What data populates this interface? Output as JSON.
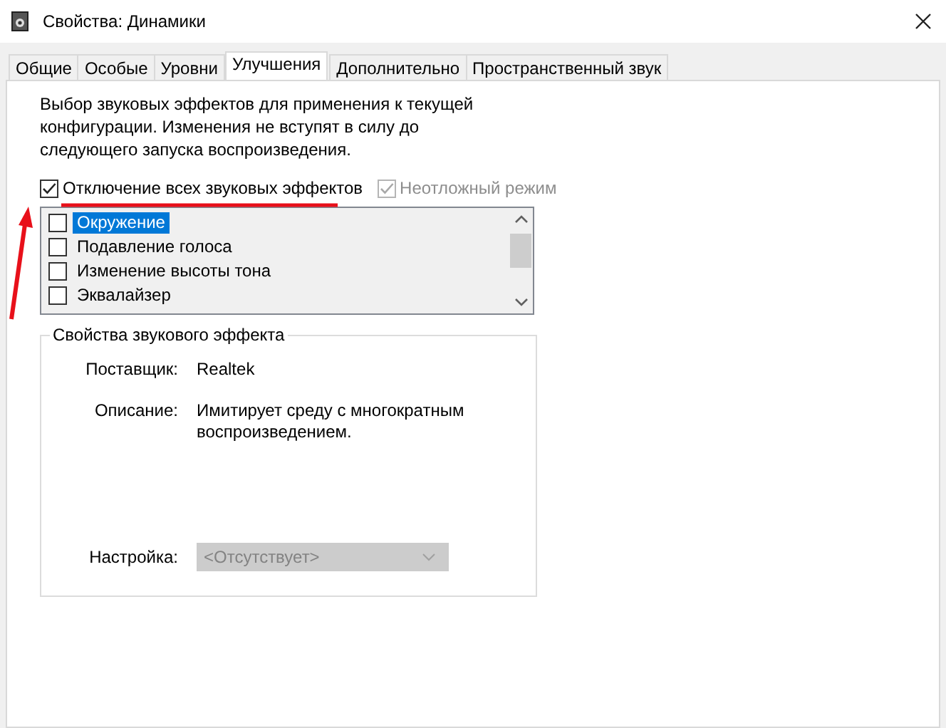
{
  "window": {
    "title": "Свойства: Динамики"
  },
  "tabs": [
    {
      "label": "Общие",
      "selected": false
    },
    {
      "label": "Особые",
      "selected": false
    },
    {
      "label": "Уровни",
      "selected": false
    },
    {
      "label": "Улучшения",
      "selected": true
    },
    {
      "label": "Дополнительно",
      "selected": false
    },
    {
      "label": "Пространственный звук",
      "selected": false
    }
  ],
  "description": "Выбор звуковых эффектов для применения к текущей конфигурации. Изменения не вступят в силу до следующего запуска воспроизведения.",
  "options": [
    {
      "label": "Отключение всех звуковых эффектов",
      "checked": true,
      "disabled": false
    },
    {
      "label": "Неотложный режим",
      "checked": true,
      "disabled": true
    }
  ],
  "effects": [
    {
      "label": "Окружение",
      "checked": false,
      "selected": true
    },
    {
      "label": "Подавление голоса",
      "checked": false,
      "selected": false
    },
    {
      "label": "Изменение высоты тона",
      "checked": false,
      "selected": false
    },
    {
      "label": "Эквалайзер",
      "checked": false,
      "selected": false
    }
  ],
  "effect_properties": {
    "title": "Свойства звукового эффекта",
    "rows": [
      {
        "label": "Поставщик:",
        "value": "Realtek"
      },
      {
        "label": "Описание:",
        "value": "Имитирует среду с многократным воспроизведением."
      }
    ],
    "setting": {
      "label": "Настройка:",
      "value": "<Отсутствует>",
      "disabled": true
    }
  }
}
